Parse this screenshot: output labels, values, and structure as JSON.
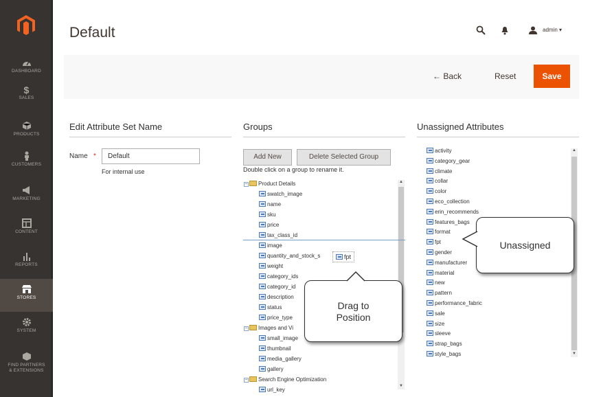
{
  "sidebar": {
    "items": [
      {
        "label": "DASHBOARD",
        "icon": "dashboard-icon"
      },
      {
        "label": "$",
        "sub": "SALES",
        "icon": "dollar-icon"
      },
      {
        "label": "PRODUCTS",
        "icon": "cube-icon"
      },
      {
        "label": "CUSTOMERS",
        "icon": "person-icon"
      },
      {
        "label": "MARKETING",
        "icon": "megaphone-icon"
      },
      {
        "label": "CONTENT",
        "icon": "layout-icon"
      },
      {
        "label": "REPORTS",
        "icon": "bar-chart-icon"
      },
      {
        "label": "STORES",
        "icon": "store-icon"
      },
      {
        "label": "SYSTEM",
        "icon": "gear-icon"
      },
      {
        "label": "FIND PARTNERS",
        "sub": "& EXTENSIONS",
        "icon": "partners-icon"
      }
    ]
  },
  "header": {
    "title": "Default",
    "user": "admin ▾"
  },
  "actions": {
    "back": "←  Back",
    "reset": "Reset",
    "save": "Save"
  },
  "edit_name": {
    "title": "Edit Attribute Set Name",
    "label": "Name",
    "required": "*",
    "value": "Default",
    "note": "For internal use"
  },
  "groups": {
    "title": "Groups",
    "add_new": "Add New",
    "delete_group": "Delete Selected Group",
    "hint": "Double click on a group to rename it.",
    "tree": [
      {
        "type": "group",
        "label": "Product Details"
      },
      {
        "type": "leaf",
        "label": "swatch_image"
      },
      {
        "type": "leaf",
        "label": "name"
      },
      {
        "type": "leaf",
        "label": "sku"
      },
      {
        "type": "leaf",
        "label": "price"
      },
      {
        "type": "leaf",
        "label": "tax_class_id"
      },
      {
        "type": "leaf",
        "label": "image"
      },
      {
        "type": "leaf",
        "label": "quantity_and_stock_s"
      },
      {
        "type": "leaf",
        "label": "weight"
      },
      {
        "type": "leaf",
        "label": "category_ids"
      },
      {
        "type": "leaf",
        "label": "category_id"
      },
      {
        "type": "leaf",
        "label": "description"
      },
      {
        "type": "leaf",
        "label": "status"
      },
      {
        "type": "leaf",
        "label": "price_type"
      },
      {
        "type": "group",
        "label": "Images and Vi"
      },
      {
        "type": "leaf",
        "label": "small_image"
      },
      {
        "type": "leaf",
        "label": "thumbnail"
      },
      {
        "type": "leaf",
        "label": "media_gallery"
      },
      {
        "type": "leaf",
        "label": "gallery"
      },
      {
        "type": "group",
        "label": "Search Engine Optimization"
      },
      {
        "type": "leaf",
        "label": "url_key"
      }
    ],
    "dragging": "fpt"
  },
  "unassigned": {
    "title": "Unassigned Attributes",
    "items": [
      "activity",
      "category_gear",
      "climate",
      "collar",
      "color",
      "eco_collection",
      "erin_recommends",
      "features_bags",
      "format",
      "fpt",
      "gender",
      "manufacturer",
      "material",
      "new",
      "pattern",
      "performance_fabric",
      "sale",
      "size",
      "sleeve",
      "strap_bags",
      "style_bags"
    ]
  },
  "callouts": {
    "unassigned": "Unassigned",
    "drag_line1": "Drag to",
    "drag_line2": "Position"
  },
  "colors": {
    "sidebar": "#373330",
    "save": "#eb5202",
    "accent_text": "#41362f"
  }
}
